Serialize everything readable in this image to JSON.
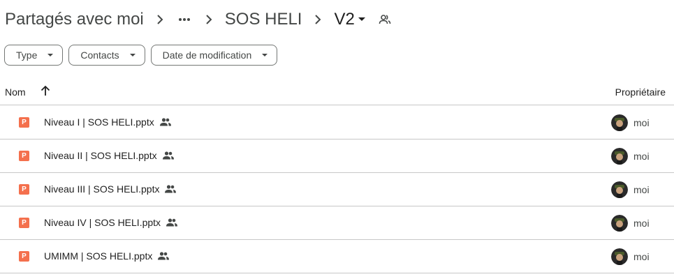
{
  "breadcrumb": {
    "root": "Partagés avec moi",
    "ellipsis": "•••",
    "folder": "SOS HELI",
    "current": "V2"
  },
  "filters": [
    {
      "label": "Type"
    },
    {
      "label": "Contacts"
    },
    {
      "label": "Date de modification"
    }
  ],
  "table": {
    "col_name": "Nom",
    "col_owner": "Propriétaire",
    "rows": [
      {
        "name": "Niveau I | SOS HELI.pptx",
        "owner": "moi",
        "icon_letter": "P"
      },
      {
        "name": "Niveau II | SOS HELI.pptx",
        "owner": "moi",
        "icon_letter": "P"
      },
      {
        "name": "Niveau III | SOS HELI.pptx",
        "owner": "moi",
        "icon_letter": "P"
      },
      {
        "name": "Niveau IV | SOS HELI.pptx",
        "owner": "moi",
        "icon_letter": "P"
      },
      {
        "name": "UMIMM | SOS HELI.pptx",
        "owner": "moi",
        "icon_letter": "P"
      }
    ]
  },
  "colors": {
    "pptx_icon": "#f4704d",
    "divider": "#c7c7c7"
  }
}
